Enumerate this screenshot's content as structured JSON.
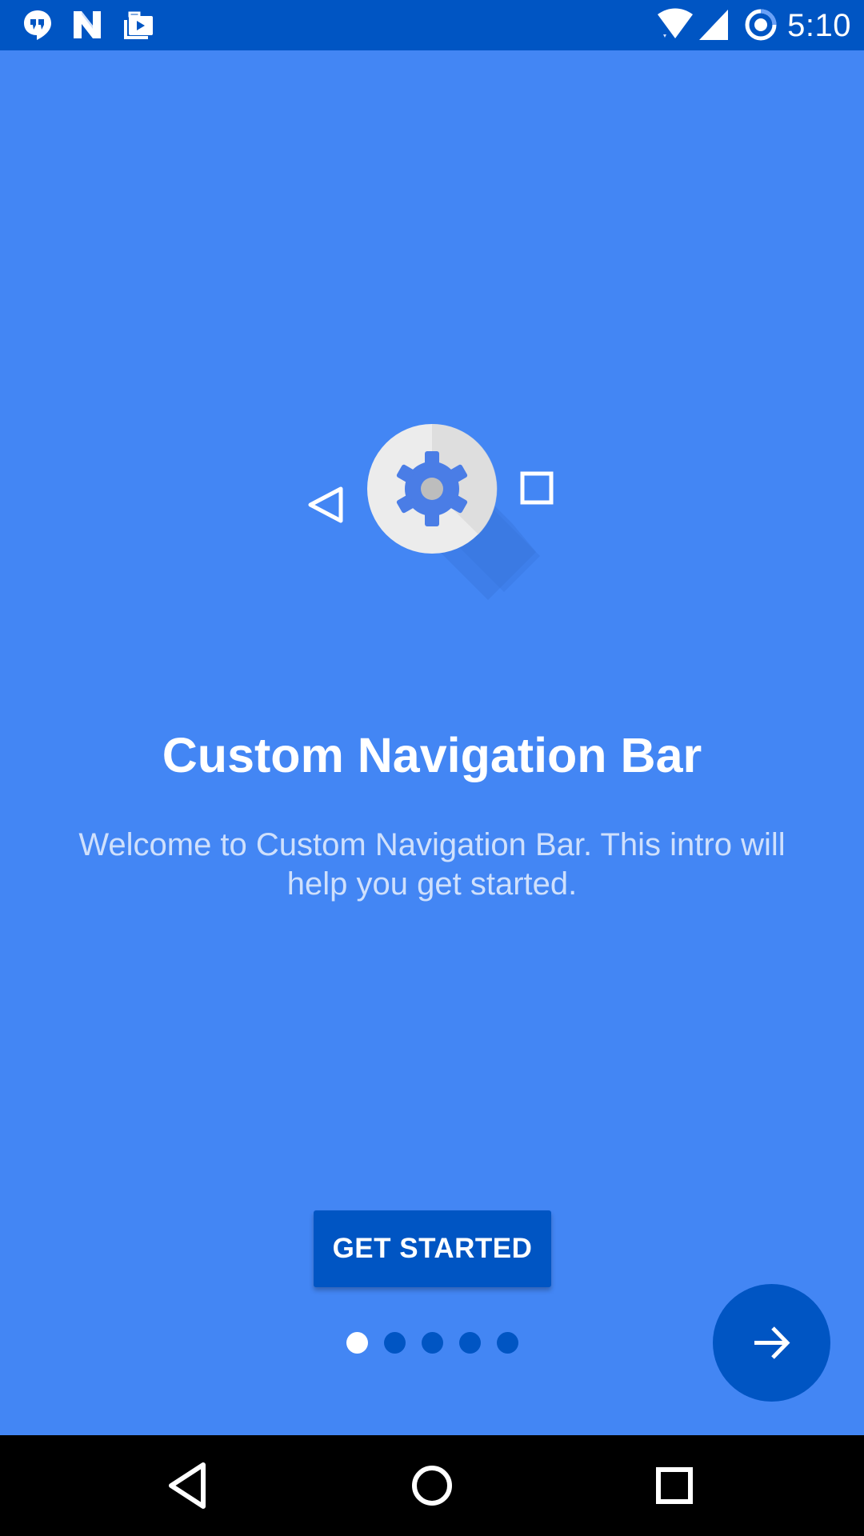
{
  "colors": {
    "background": "#4386f4",
    "status_bar": "#0055c3",
    "accent_dark": "#0055c3",
    "text_primary": "#ffffff",
    "text_secondary": "#cfe0fc",
    "hero_circle": "#ececec",
    "gear": "#4a7de6"
  },
  "status_bar": {
    "time": "5:10",
    "left_icons": [
      "hangouts-icon",
      "n-icon",
      "briefcase-play-icon"
    ],
    "right_icons": [
      "wifi-icon",
      "signal-icon",
      "sync-ring-icon"
    ]
  },
  "hero": {
    "icons": [
      "back-triangle-icon",
      "gear-icon",
      "square-icon"
    ]
  },
  "intro": {
    "title": "Custom Navigation Bar",
    "description": "Welcome to Custom Navigation Bar. This intro will help you get started."
  },
  "actions": {
    "get_started_label": "GET STARTED",
    "next_icon": "arrow-right-icon"
  },
  "pager": {
    "total": 5,
    "current": 1
  },
  "system_nav": {
    "icons": [
      "nav-back-icon",
      "nav-home-icon",
      "nav-recents-icon"
    ]
  }
}
